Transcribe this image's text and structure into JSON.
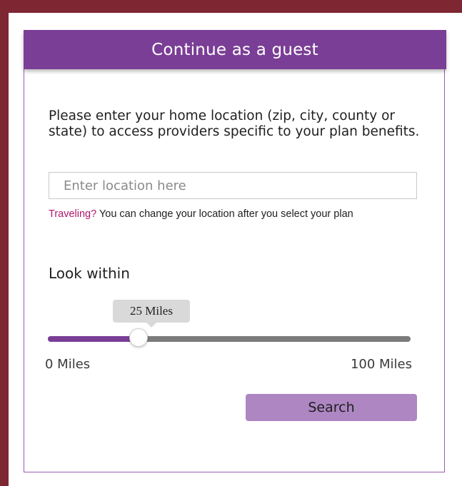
{
  "card": {
    "title": "Continue as a guest",
    "instructions": "Please enter your home location (zip, city, county or state) to access providers specific to your plan benefits."
  },
  "location": {
    "placeholder": "Enter location here",
    "value": ""
  },
  "travel_note": {
    "link": "Traveling?",
    "text": " You can change your location after you select your plan"
  },
  "distance": {
    "label": "Look within",
    "tooltip": "25 Miles",
    "min_label": "0 Miles",
    "max_label": "100 Miles",
    "min": 0,
    "max": 100,
    "value": 25
  },
  "search": {
    "label": "Search"
  },
  "colors": {
    "frame": "#7e2632",
    "brand_purple": "#7a3e96",
    "link_magenta": "#b3166a",
    "button": "#ad86c2"
  }
}
